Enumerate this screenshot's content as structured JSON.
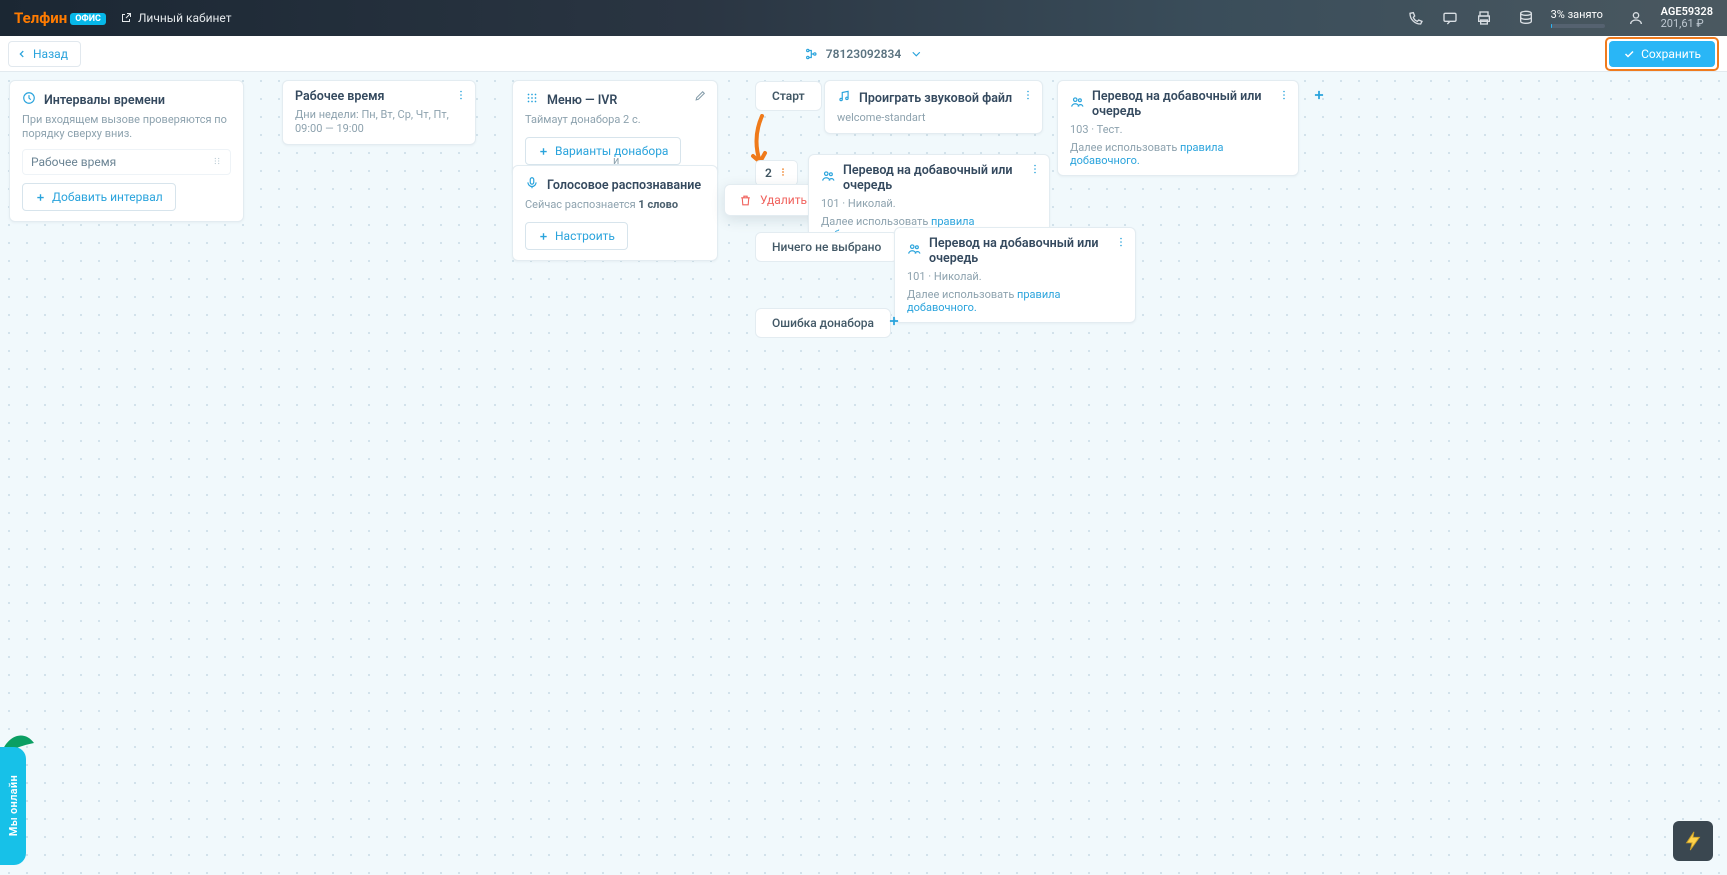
{
  "topbar": {
    "brand_part1": "Телфин",
    "brand_badge": "ОФИС",
    "account_link": "Личный кабинет",
    "usage_label": "3% занято",
    "acct_id": "AGE59328",
    "acct_balance": "201,61 ₽"
  },
  "subbar": {
    "back_label": "Назад",
    "phone_number": "78123092834",
    "save_label": "Сохранить"
  },
  "cards": {
    "intervals": {
      "title": "Интервалы времени",
      "sub": "При входящем вызове проверяются по порядку сверху вниз.",
      "row_label": "Рабочее время",
      "add_btn": "Добавить интервал"
    },
    "work_time": {
      "title": "Рабочее время",
      "sub": "Дни недели: Пн, Вт, Ср, Чт, Пт, 09:00 — 19:00"
    },
    "ivr": {
      "title": "Меню — IVR",
      "sub": "Таймаут донабора 2 с.",
      "btn": "Варианты донабора"
    },
    "separator": "и",
    "voice": {
      "title": "Голосовое распознавание",
      "sub_prefix": "Сейчас распознается ",
      "sub_bold": "1 слово",
      "btn": "Настроить"
    },
    "start_label": "Старт",
    "sound": {
      "title": "Проиграть звуковой файл",
      "sub": "welcome-standart"
    },
    "transfer1": {
      "title": "Перевод на добавочный или очередь",
      "sub": "103 · Тест.",
      "rule_prefix": "Далее использовать ",
      "rule_link": "правила добавочного."
    },
    "num2": "2",
    "popover_delete": "Удалить",
    "transfer2": {
      "title": "Перевод на добавочный или очередь",
      "sub": "101 · Николай.",
      "rule_prefix": "Далее использовать ",
      "rule_link": "правила добавочного."
    },
    "nothing_label": "Ничего не выбрано",
    "transfer3": {
      "title": "Перевод на добавочный или очередь",
      "sub": "101 · Николай.",
      "rule_prefix": "Далее использовать ",
      "rule_link": "правила добавочного."
    },
    "error_label": "Ошибка донабора"
  },
  "side_tab": "Мы онлайн"
}
